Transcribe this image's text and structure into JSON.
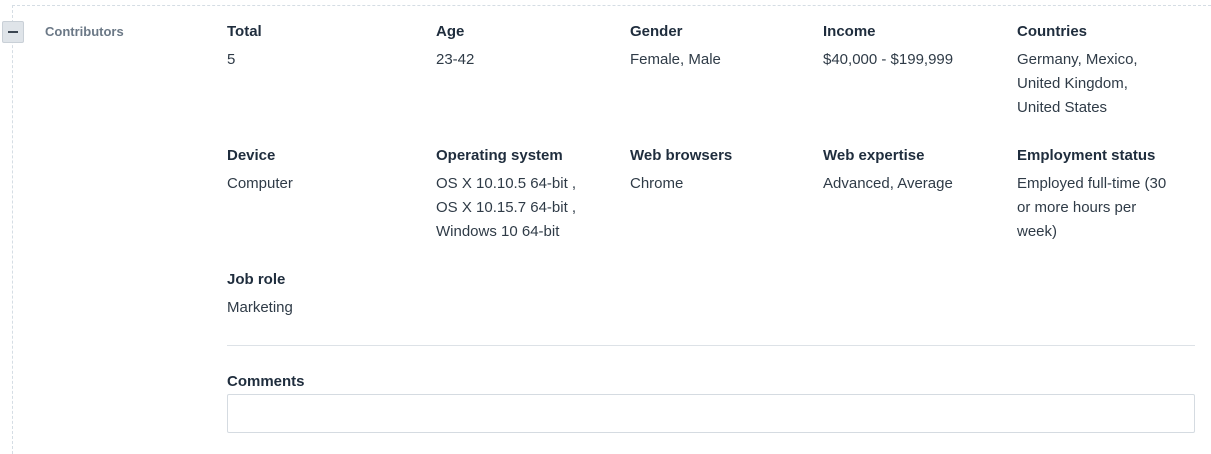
{
  "section": {
    "label": "Contributors",
    "toggle_symbol": "−"
  },
  "fields": {
    "total": {
      "title": "Total",
      "value": "5"
    },
    "age": {
      "title": "Age",
      "value": "23-42"
    },
    "gender": {
      "title": "Gender",
      "value": "Female, Male"
    },
    "income": {
      "title": "Income",
      "value": "$40,000 - $199,999"
    },
    "countries": {
      "title": "Countries",
      "value_lines": [
        "Germany, Mexico,",
        "United Kingdom,",
        "United States"
      ]
    },
    "device": {
      "title": "Device",
      "value": "Computer"
    },
    "os": {
      "title": "Operating system",
      "value_lines": [
        "OS X 10.10.5 64-bit ,",
        "OS X 10.15.7 64-bit ,",
        "Windows 10 64-bit"
      ]
    },
    "browsers": {
      "title": "Web browsers",
      "value": "Chrome"
    },
    "expertise": {
      "title": "Web expertise",
      "value": "Advanced, Average"
    },
    "employment": {
      "title": "Employment status",
      "value_lines": [
        "Employed full-time (30",
        "or more hours per",
        "week)"
      ]
    },
    "job_role": {
      "title": "Job role",
      "value": "Marketing"
    }
  },
  "comments": {
    "title": "Comments",
    "value": ""
  }
}
